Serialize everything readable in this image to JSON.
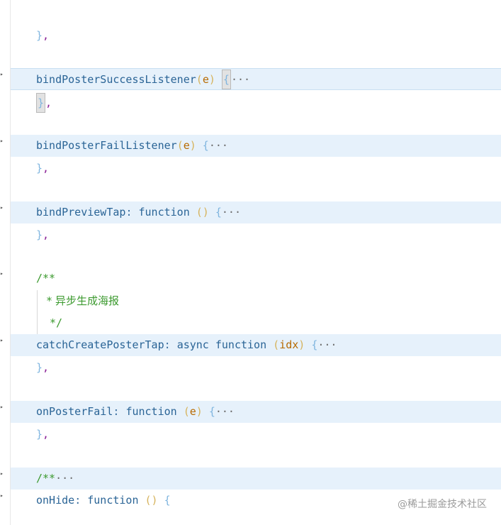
{
  "editor": {
    "lines": [
      {
        "id": "l1",
        "parts": [
          {
            "t": "}",
            "c": "brace"
          },
          {
            "t": ",",
            "c": "comma"
          }
        ]
      },
      {
        "id": "l2",
        "parts": [
          {
            "t": "bindPosterSuccessListener",
            "c": "fn"
          },
          {
            "t": "(",
            "c": "paren"
          },
          {
            "t": "e",
            "c": "param"
          },
          {
            "t": ")",
            "c": "paren"
          },
          {
            "t": " ",
            "c": "plain"
          },
          {
            "t": "{",
            "c": "brace-box"
          },
          {
            "t": "···",
            "c": "ellipsis"
          }
        ]
      },
      {
        "id": "l3",
        "parts": [
          {
            "t": "}",
            "c": "brace-box"
          },
          {
            "t": ",",
            "c": "comma"
          }
        ]
      },
      {
        "id": "l4",
        "parts": [
          {
            "t": "bindPosterFailListener",
            "c": "fn"
          },
          {
            "t": "(",
            "c": "paren"
          },
          {
            "t": "e",
            "c": "param"
          },
          {
            "t": ")",
            "c": "paren"
          },
          {
            "t": " {",
            "c": "brace"
          },
          {
            "t": "···",
            "c": "ellipsis"
          }
        ]
      },
      {
        "id": "l5",
        "parts": [
          {
            "t": "}",
            "c": "brace"
          },
          {
            "t": ",",
            "c": "comma"
          }
        ]
      },
      {
        "id": "l6",
        "parts": [
          {
            "t": "bindPreviewTap",
            "c": "fn"
          },
          {
            "t": ": ",
            "c": "plain"
          },
          {
            "t": "function",
            "c": "kw"
          },
          {
            "t": " ",
            "c": "plain"
          },
          {
            "t": "()",
            "c": "paren"
          },
          {
            "t": " {",
            "c": "brace"
          },
          {
            "t": "···",
            "c": "ellipsis"
          }
        ]
      },
      {
        "id": "l7",
        "parts": [
          {
            "t": "}",
            "c": "brace"
          },
          {
            "t": ",",
            "c": "comma"
          }
        ]
      },
      {
        "id": "l8",
        "parts": [
          {
            "t": "/**",
            "c": "comment mono"
          }
        ]
      },
      {
        "id": "l9",
        "parts": [
          {
            "t": " * 异步生成海报",
            "c": "comment"
          }
        ]
      },
      {
        "id": "l10",
        "parts": [
          {
            "t": " */",
            "c": "comment mono"
          }
        ]
      },
      {
        "id": "l11",
        "parts": [
          {
            "t": "catchCreatePosterTap",
            "c": "fn"
          },
          {
            "t": ": ",
            "c": "plain"
          },
          {
            "t": "async",
            "c": "kw"
          },
          {
            "t": " ",
            "c": "plain"
          },
          {
            "t": "function",
            "c": "kw"
          },
          {
            "t": " ",
            "c": "plain"
          },
          {
            "t": "(",
            "c": "paren"
          },
          {
            "t": "idx",
            "c": "param"
          },
          {
            "t": ")",
            "c": "paren"
          },
          {
            "t": " {",
            "c": "brace"
          },
          {
            "t": "···",
            "c": "ellipsis"
          }
        ]
      },
      {
        "id": "l12",
        "parts": [
          {
            "t": "}",
            "c": "brace"
          },
          {
            "t": ",",
            "c": "comma"
          }
        ]
      },
      {
        "id": "l13",
        "parts": [
          {
            "t": "onPosterFail",
            "c": "fn"
          },
          {
            "t": ": ",
            "c": "plain"
          },
          {
            "t": "function",
            "c": "kw"
          },
          {
            "t": " ",
            "c": "plain"
          },
          {
            "t": "(",
            "c": "paren"
          },
          {
            "t": "e",
            "c": "param"
          },
          {
            "t": ")",
            "c": "paren"
          },
          {
            "t": " {",
            "c": "brace"
          },
          {
            "t": "···",
            "c": "ellipsis"
          }
        ]
      },
      {
        "id": "l14",
        "parts": [
          {
            "t": "}",
            "c": "brace"
          },
          {
            "t": ",",
            "c": "comma"
          }
        ]
      },
      {
        "id": "l15",
        "parts": [
          {
            "t": "/**",
            "c": "comment mono"
          },
          {
            "t": "···",
            "c": "ellipsis"
          }
        ]
      },
      {
        "id": "l16",
        "parts": [
          {
            "t": "onHide",
            "c": "fn"
          },
          {
            "t": ": ",
            "c": "plain"
          },
          {
            "t": "function",
            "c": "kw"
          },
          {
            "t": " ",
            "c": "plain"
          },
          {
            "t": "()",
            "c": "paren"
          },
          {
            "t": " {",
            "c": "brace"
          }
        ]
      }
    ]
  },
  "watermark": "@稀土掘金技术社区",
  "colors": {
    "fold_highlight": "#e6f1fb",
    "function_name": "#2a6496",
    "comment": "#3c9a2f",
    "comma": "#8a1f96",
    "param": "#b76a00"
  }
}
